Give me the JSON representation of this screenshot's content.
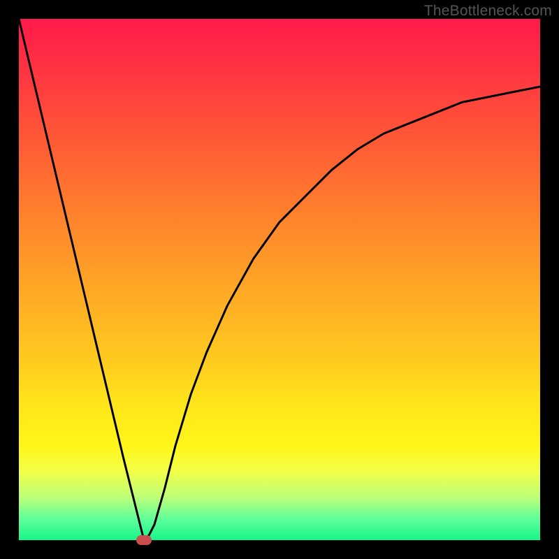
{
  "watermark": "TheBottleneck.com",
  "colors": {
    "frame": "#000000",
    "marker": "#c94f4f",
    "curve": "#000000"
  },
  "chart_data": {
    "type": "line",
    "title": "",
    "xlabel": "",
    "ylabel": "",
    "xlim": [
      0,
      100
    ],
    "ylim": [
      0,
      100
    ],
    "grid": false,
    "series": [
      {
        "name": "bottleneck-curve",
        "x": [
          0,
          5,
          10,
          15,
          20,
          24,
          25,
          26,
          28,
          30,
          33,
          36,
          40,
          45,
          50,
          55,
          60,
          65,
          70,
          75,
          80,
          85,
          90,
          95,
          100
        ],
        "values": [
          100,
          79,
          58,
          37,
          16,
          0,
          1,
          3,
          10,
          18,
          28,
          36,
          45,
          54,
          61,
          66,
          71,
          75,
          78,
          80,
          82,
          84,
          85,
          86,
          87
        ]
      }
    ],
    "marker": {
      "x": 24,
      "y": 0
    }
  }
}
